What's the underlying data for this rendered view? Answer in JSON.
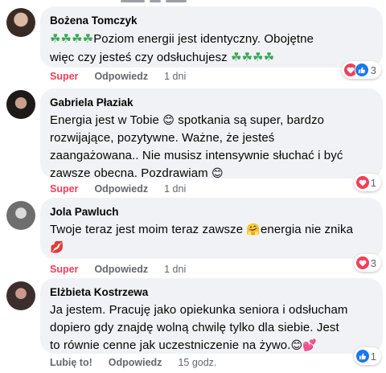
{
  "comments": [
    {
      "author": "Bożena Tomczyk",
      "text_main": "Poziom energii jest identyczny. Obojętne",
      "text_line2": "więc czy jesteś czy odsłuchujesz",
      "actions": {
        "like": "Super",
        "reply": "Odpowiedz",
        "time": "1 dni"
      },
      "reaction_count": "3"
    },
    {
      "author": "Gabriela Płaziak",
      "lines": [
        "Energia jest w Tobie",
        "spotkania są super, bardzo",
        "rozwijające, pozytywne. Ważne, że jesteś",
        "zaangażowana.. Nie musisz intensywnie słuchać i być",
        "zawsze obecna. Pozdrawiam"
      ],
      "actions": {
        "like": "Super",
        "reply": "Odpowiedz",
        "time": "1 dni"
      },
      "reaction_count": "1"
    },
    {
      "author": "Jola Pawluch",
      "line1a": "Twoje teraz jest moim teraz zawsze",
      "line1b": "energia nie znika",
      "actions": {
        "like": "Super",
        "reply": "Odpowiedz",
        "time": "1 dni"
      },
      "reaction_count": "3"
    },
    {
      "author": "Elżbieta Kostrzewa",
      "lines": [
        "Ja jestem. Pracuję jako opiekunka seniora i odsłucham",
        "dopiero gdy znajdę wolną chwilę tylko dla siebie. Jest",
        "to równie cenne jak uczestniczenie na żywo."
      ],
      "actions": {
        "like": "Lubię to!",
        "reply": "Odpowiedz",
        "time": "15 godz."
      },
      "reaction_count": "1"
    }
  ],
  "icons": {
    "clover": "four-leaf-clover",
    "heart": "heart-reaction",
    "like": "like-reaction"
  },
  "colors": {
    "super": "#f33e58",
    "bubble": "#f0f2f5",
    "like_blue": "#1877f2"
  }
}
